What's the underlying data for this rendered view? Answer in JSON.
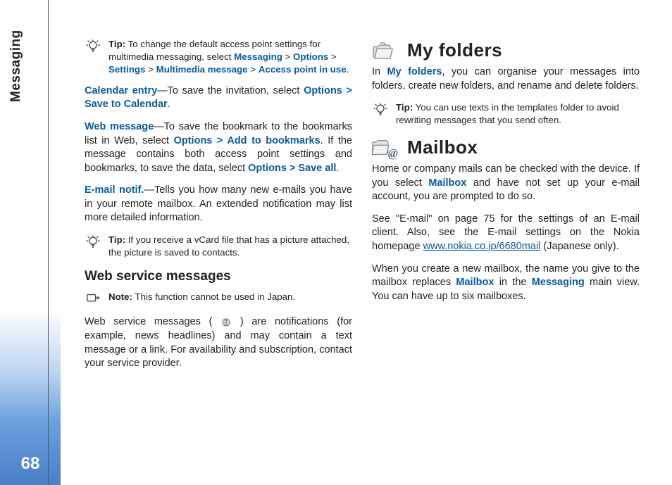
{
  "section": "Messaging",
  "page_number": "68",
  "left": {
    "tip1_label": "Tip:",
    "tip1_body": " To change the default access point settings for multimedia messaging, select ",
    "tip1_path": [
      "Messaging",
      "Options",
      "Settings",
      "Multimedia message",
      "Access point in use"
    ],
    "cal_lead": "Calendar entry",
    "cal_body": "—To save the invitation, select ",
    "cal_action": "Options > Save to Calendar",
    "web_lead": "Web message",
    "web_body1": "—To save the bookmark to the bookmarks list in Web, select  ",
    "web_action1": "Options > Add to bookmarks",
    "web_body2": ". If the message contains both access point settings and bookmarks, to save the data, select ",
    "web_action2": "Options > Save all",
    "email_lead": "E-mail notif.",
    "email_body": "—Tells you how many new e-mails you have in your remote mailbox. An extended notification may list more detailed information.",
    "tip2_label": "Tip:",
    "tip2_body": " If you receive a vCard file that has a picture attached, the picture is saved to contacts.",
    "h2": "Web service messages",
    "note_label": "Note:",
    "note_body": " This function cannot be used in Japan.",
    "wsm_a": "Web service messages ( ",
    "wsm_b": " ) are notifications (for example, news headlines) and may contain a text message or a link. For availability and subscription, contact your service provider."
  },
  "right": {
    "h1_folders": "My folders",
    "folders_lead": "In ",
    "folders_label": "My folders",
    "folders_body": ", you can organise your messages into folders, create new folders, and rename and delete folders.",
    "tip_label": "Tip:",
    "tip_body": "  You can use texts in the templates folder to avoid rewriting messages that you send often.",
    "h1_mailbox": "Mailbox",
    "mb_p1a": "Home or company mails can be checked with the device. If you select ",
    "mb_lbl": "Mailbox",
    "mb_p1b": " and have not set up your e-mail account, you are prompted to do so.",
    "mb_p2a": "See \"E-mail\" on page 75 for the settings of an E-mail client. Also, see the E-mail settings on the Nokia homepage ",
    "mb_link": "www.nokia.co.jp/6680mail",
    "mb_p2b": " (Japanese only).",
    "mb_p3a": "When you create a new mailbox, the name you give to the mailbox replaces ",
    "mb_p3b": " in the ",
    "mb_lbl2": "Messaging",
    "mb_p3c": " main view. You can have up to six mailboxes."
  }
}
